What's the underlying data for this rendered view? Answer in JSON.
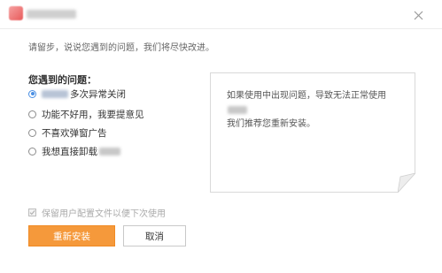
{
  "window": {
    "close_label": "×"
  },
  "subtitle": "请留步，说说您遇到的问题，我们将尽快改进。",
  "reasons": {
    "heading": "您遇到的问题：",
    "items": [
      {
        "label": "多次异常关闭",
        "checked": true
      },
      {
        "label": "功能不好用，我要提意见",
        "checked": false
      },
      {
        "label": "不喜欢弹窗广告",
        "checked": false
      },
      {
        "label": "我想直接卸载",
        "checked": false
      }
    ]
  },
  "info_panel": {
    "line1": "如果使用中出现问题，导致无法正常使用",
    "line2": "我们推荐您重新安装。"
  },
  "keep_config": {
    "label": "保留用户配置文件以便下次使用",
    "checked": true
  },
  "buttons": {
    "reinstall": "重新安装",
    "cancel": "取消"
  },
  "colors": {
    "primary": "#f5993b",
    "radio_accent": "#4a8fe3"
  }
}
